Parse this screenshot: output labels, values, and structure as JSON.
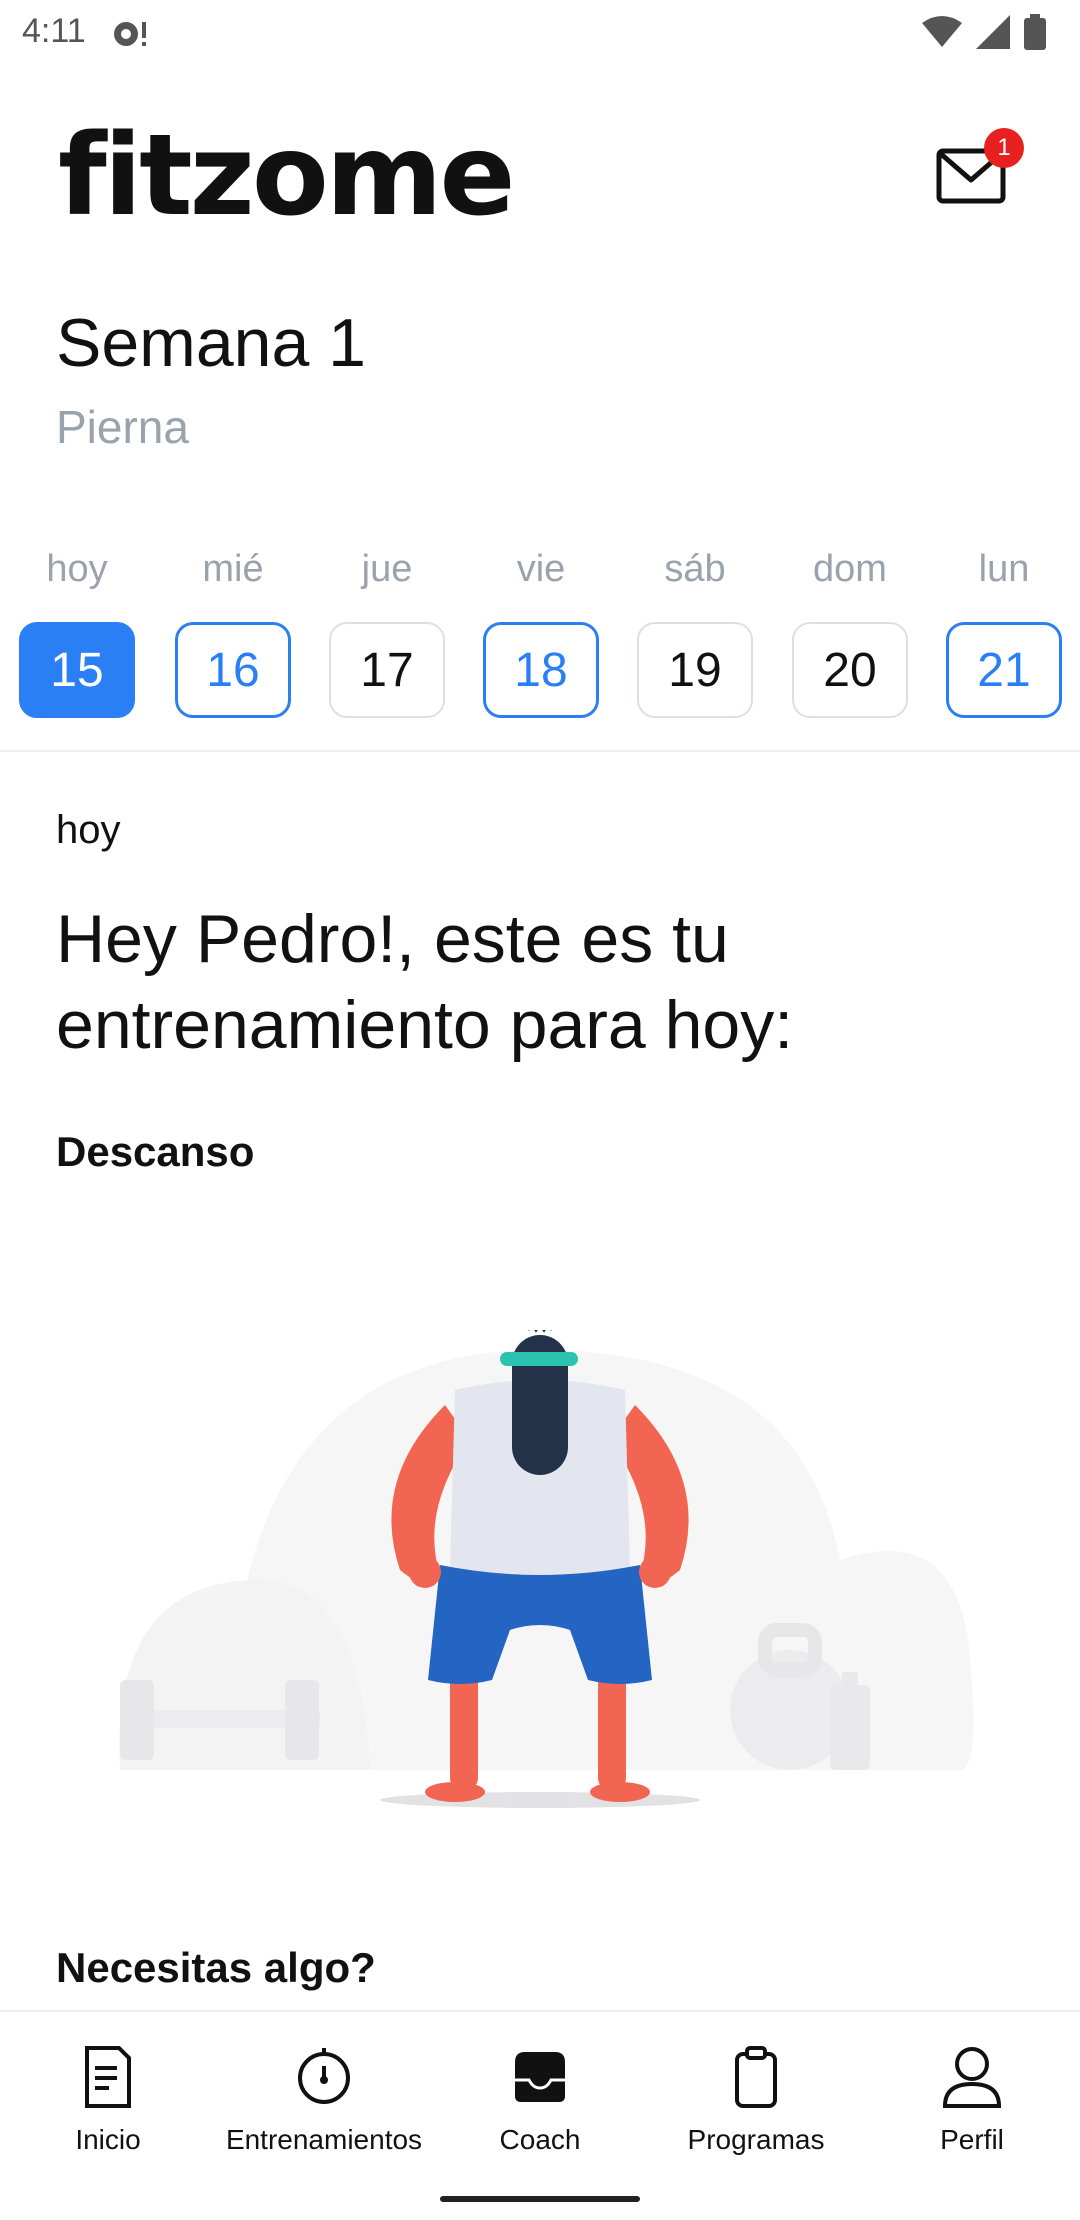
{
  "status_bar": {
    "time": "4:11"
  },
  "header": {
    "logo": "fitzome",
    "mail_badge": "1"
  },
  "week": {
    "title": "Semana 1",
    "subtitle": "Pierna"
  },
  "days": [
    {
      "label": "hoy",
      "number": "15",
      "state": "active"
    },
    {
      "label": "mié",
      "number": "16",
      "state": "planned"
    },
    {
      "label": "jue",
      "number": "17",
      "state": "plain"
    },
    {
      "label": "vie",
      "number": "18",
      "state": "planned"
    },
    {
      "label": "sáb",
      "number": "19",
      "state": "plain"
    },
    {
      "label": "dom",
      "number": "20",
      "state": "plain"
    },
    {
      "label": "lun",
      "number": "21",
      "state": "planned"
    }
  ],
  "content": {
    "today_label": "hoy",
    "greeting": "Hey Pedro!, este es tu entrenamiento para hoy:",
    "workout": "Descanso",
    "help_title": "Necesitas algo?"
  },
  "nav": [
    {
      "label": "Inicio",
      "icon": "document-icon"
    },
    {
      "label": "Entrenamientos",
      "icon": "stopwatch-icon"
    },
    {
      "label": "Coach",
      "icon": "inbox-icon"
    },
    {
      "label": "Programas",
      "icon": "clipboard-icon"
    },
    {
      "label": "Perfil",
      "icon": "person-icon"
    }
  ],
  "colors": {
    "accent": "#2b7ff5",
    "badge": "#e8201f",
    "muted": "#9aa3ad"
  }
}
